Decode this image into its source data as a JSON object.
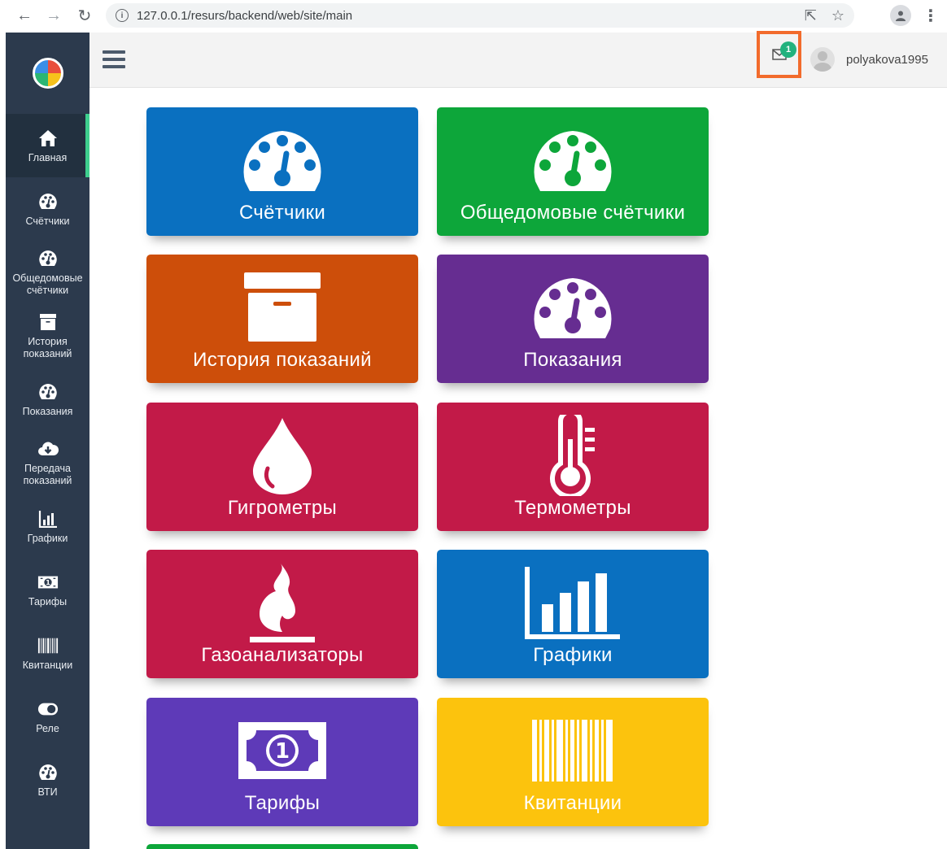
{
  "browser": {
    "url": "127.0.0.1/resurs/backend/web/site/main"
  },
  "header": {
    "notification_count": "1",
    "username": "polyakova1995"
  },
  "sidebar": {
    "items": [
      {
        "label": "Главная",
        "icon": "home-icon",
        "active": true
      },
      {
        "label": "Счётчики",
        "icon": "gauge-icon"
      },
      {
        "label": "Общедомовые счётчики",
        "icon": "gauge-icon"
      },
      {
        "label": "История показаний",
        "icon": "archive-icon"
      },
      {
        "label": "Показания",
        "icon": "gauge-icon"
      },
      {
        "label": "Передача показаний",
        "icon": "cloud-download-icon"
      },
      {
        "label": "Графики",
        "icon": "bar-chart-icon"
      },
      {
        "label": "Тарифы",
        "icon": "money-icon"
      },
      {
        "label": "Квитанции",
        "icon": "barcode-icon"
      },
      {
        "label": "Реле",
        "icon": "toggle-icon"
      },
      {
        "label": "ВТИ",
        "icon": "gauge-icon"
      }
    ]
  },
  "tiles": [
    {
      "label": "Счётчики",
      "color": "#0a70c0",
      "icon": "gauge-icon"
    },
    {
      "label": "Общедомовые счётчики",
      "color": "#0da63a",
      "icon": "gauge-icon"
    },
    {
      "label": "История показаний",
      "color": "#cd4e0a",
      "icon": "archive-icon"
    },
    {
      "label": "Показания",
      "color": "#662d91",
      "icon": "gauge-icon"
    },
    {
      "label": "Гигрометры",
      "color": "#c21a48",
      "icon": "drop-icon"
    },
    {
      "label": "Термометры",
      "color": "#c21a48",
      "icon": "thermometer-icon"
    },
    {
      "label": "Газоанализаторы",
      "color": "#c21a48",
      "icon": "flame-icon"
    },
    {
      "label": "Графики",
      "color": "#0a70c0",
      "icon": "bar-chart-icon"
    },
    {
      "label": "Тарифы",
      "color": "#5e3ab8",
      "icon": "money-icon"
    },
    {
      "label": "Квитанции",
      "color": "#fcc30d",
      "icon": "barcode-icon"
    }
  ],
  "colors": {
    "sidebar_bg": "#2c3a4d",
    "active_indicator": "#3ecf8e",
    "notification_highlight": "#f26b2c",
    "badge": "#23b27e"
  }
}
